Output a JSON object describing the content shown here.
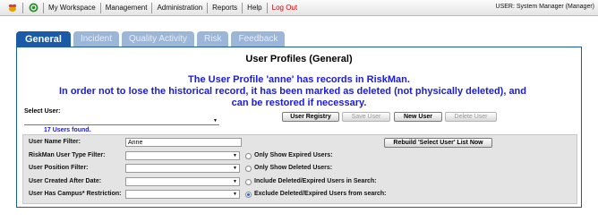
{
  "menu": {
    "items": [
      "My Workspace",
      "Management",
      "Administration",
      "Reports",
      "Help"
    ],
    "logout": "Log Out",
    "user": "USER: System Manager (Manager)"
  },
  "tabs": [
    {
      "label": "General",
      "active": true
    },
    {
      "label": "Incident",
      "active": false
    },
    {
      "label": "Quality Activity",
      "active": false
    },
    {
      "label": "Risk",
      "active": false
    },
    {
      "label": "Feedback",
      "active": false
    }
  ],
  "page": {
    "title": "User Profiles (General)",
    "message_line1": "The User Profile 'anne' has records in RiskMan.",
    "message_line2": "In order not to lose the historical record, it has been marked as deleted (not physically deleted), and",
    "message_line3": "can be restored if necessary."
  },
  "select_user": {
    "label": "Select User:",
    "value": "",
    "found_text": "17 Users found."
  },
  "buttons": {
    "registry": "User Registry",
    "save": "Save User",
    "new": "New User",
    "delete": "Delete User",
    "rebuild": "Rebuild 'Select User' List Now"
  },
  "filters": {
    "name_label": "User Name Filter:",
    "name_value": "Anne",
    "type_label": "RiskMan User Type Filter:",
    "position_label": "User Position Filter:",
    "created_label": "User Created After Date:",
    "campus_label": "User Has Campus* Restriction:",
    "opt_expired": "Only Show Expired Users:",
    "opt_deleted": "Only Show Deleted Users:",
    "opt_include": "Include Deleted/Expired Users in Search:",
    "opt_exclude": "Exclude Deleted/Expired Users from search:",
    "selected_option": "Exclude Deleted/Expired Users from search:"
  },
  "colors": {
    "tab_active": "#1a5aa6",
    "tab_inactive": "#9cb6d8",
    "message": "#1a1ae0",
    "logout": "#d00000"
  }
}
